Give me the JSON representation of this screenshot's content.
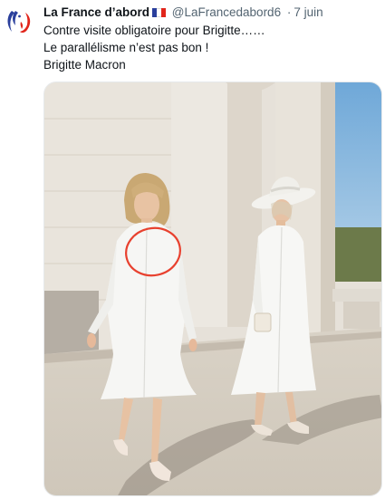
{
  "tweet": {
    "author_name": "La France d’abord",
    "author_flag": "france-flag-icon",
    "handle": "@LaFrancedabord6",
    "separator": "·",
    "date": "7 juin",
    "lines": [
      "Contre visite obligatoire pour Brigitte……",
      "Le parallélisme n’est pas bon !",
      "Brigitte Macron"
    ]
  },
  "avatar": {
    "icon": "marianne-logo-icon",
    "colors": {
      "blue": "#2a3f9c",
      "red": "#e1251b"
    }
  },
  "media": {
    "description_icon": "photo-two-women-white-dresses",
    "annotation_color": "#e8412f"
  },
  "colors": {
    "text": "#0f1419",
    "muted": "#536471"
  }
}
